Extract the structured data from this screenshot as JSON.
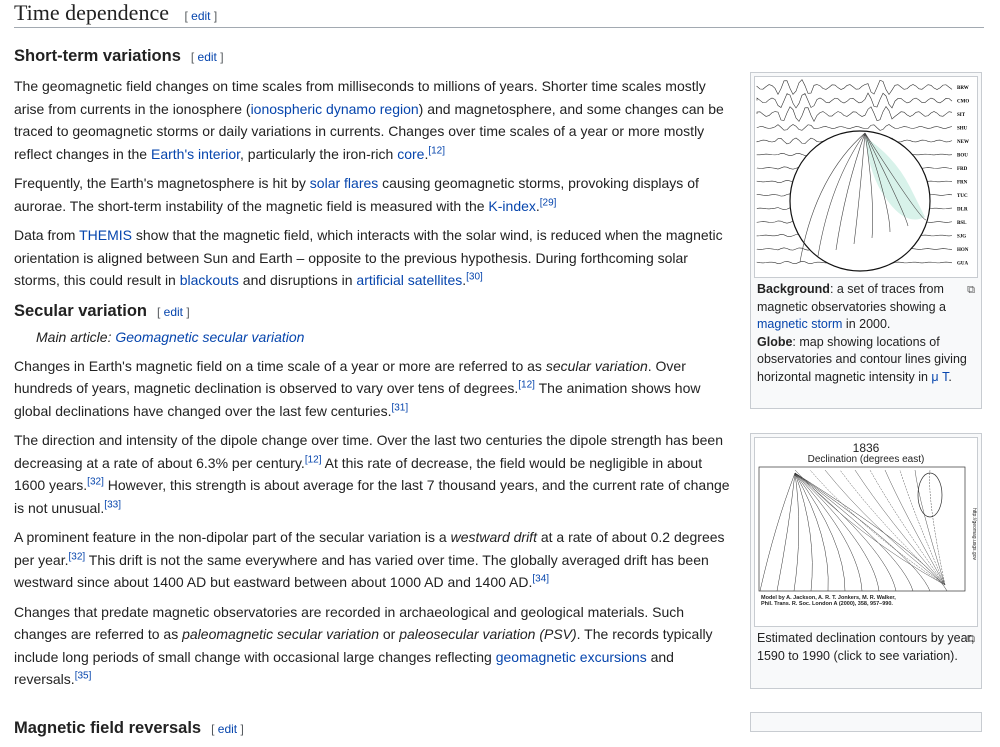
{
  "section": {
    "title": "Time dependence",
    "edit": "edit"
  },
  "edit_open": "[",
  "edit_close": "]",
  "subsections": [
    {
      "title": "Short-term variations",
      "edit": "edit",
      "hatnote": null,
      "paragraphs": [
        [
          {
            "t": "The geomagnetic field changes on time scales from milliseconds to millions of years. Shorter time scales mostly arise from currents in the ionosphere ("
          },
          {
            "t": "ionospheric dynamo region",
            "link": 1
          },
          {
            "t": ") and magnetosphere, and some changes can be traced to geomagnetic storms or daily variations in currents. Changes over time scales of a year or more mostly reflect changes in the "
          },
          {
            "t": "Earth's interior",
            "link": 1
          },
          {
            "t": ", particularly the iron-rich "
          },
          {
            "t": "core",
            "link": 1
          },
          {
            "t": ".",
            "sup": "[12]"
          }
        ],
        [
          {
            "t": "Frequently, the Earth's magnetosphere is hit by "
          },
          {
            "t": "solar flares",
            "link": 1
          },
          {
            "t": " causing geomagnetic storms, provoking displays of aurorae. The short-term instability of the magnetic field is measured with the "
          },
          {
            "t": "K-index",
            "link": 1
          },
          {
            "t": ".",
            "sup": "[29]"
          }
        ],
        [
          {
            "t": "Data from "
          },
          {
            "t": "THEMIS",
            "link": 1
          },
          {
            "t": " show that the magnetic field, which interacts with the solar wind, is reduced when the magnetic orientation is aligned between Sun and Earth – opposite to the previous hypothesis. During forthcoming solar storms, this could result in "
          },
          {
            "t": "blackouts",
            "link": 1
          },
          {
            "t": " and disruptions in "
          },
          {
            "t": "artificial satellites",
            "link": 1
          },
          {
            "t": ".",
            "sup": "[30]"
          }
        ]
      ]
    },
    {
      "title": "Secular variation",
      "edit": "edit",
      "hatnote": {
        "label": "Main article: ",
        "link": "Geomagnetic secular variation"
      },
      "paragraphs": [
        [
          {
            "t": "Changes in Earth's magnetic field on a time scale of a year or more are referred to as "
          },
          {
            "t": "secular variation",
            "i": 1
          },
          {
            "t": ". Over hundreds of years, magnetic declination is observed to vary over tens of degrees.",
            "sup": "[12]"
          },
          {
            "t": " The animation shows how global declinations have changed over the last few centuries.",
            "sup": "[31]"
          }
        ],
        [
          {
            "t": "The direction and intensity of the dipole change over time. Over the last two centuries the dipole strength has been decreasing at a rate of about 6.3% per century.",
            "sup": "[12]"
          },
          {
            "t": " At this rate of decrease, the field would be negligible in about 1600 years.",
            "sup": "[32]"
          },
          {
            "t": " However, this strength is about average for the last 7 thousand years, and the current rate of change is not unusual.",
            "sup": "[33]"
          }
        ],
        [
          {
            "t": "A prominent feature in the non-dipolar part of the secular variation is a "
          },
          {
            "t": "westward drift",
            "i": 1
          },
          {
            "t": " at a rate of about 0.2 degrees per year.",
            "sup": "[32]"
          },
          {
            "t": " This drift is not the same everywhere and has varied over time. The globally averaged drift has been westward since about 1400 AD but eastward between about 1000 AD and 1400 AD.",
            "sup": "[34]"
          }
        ],
        [
          {
            "t": "Changes that predate magnetic observatories are recorded in archaeological and geological materials. Such changes are referred to as "
          },
          {
            "t": "paleomagnetic secular variation",
            "i": 1
          },
          {
            "t": " or "
          },
          {
            "t": "paleosecular variation (PSV)",
            "i": 1
          },
          {
            "t": ". The records typically include long periods of small change with occasional large changes reflecting "
          },
          {
            "t": "geomagnetic excursions",
            "link": 1
          },
          {
            "t": " and reversals.",
            "sup": "[35]"
          }
        ]
      ]
    },
    {
      "title": "Magnetic field reversals",
      "edit": "edit",
      "hatnote": null,
      "paragraphs": []
    }
  ],
  "figures": [
    {
      "stations": [
        "BRW",
        "CMO",
        "SIT",
        "SHU",
        "NEW",
        "BOU",
        "FRD",
        "FRN",
        "TUC",
        "DLR",
        "BSL",
        "SJG",
        "HON",
        "GUA"
      ],
      "caption": [
        {
          "t": "Background",
          "b": 1
        },
        {
          "t": ": a set of traces from magnetic observatories showing a "
        },
        {
          "t": "magnetic storm",
          "link": 1
        },
        {
          "t": " in 2000."
        },
        {
          "br": 1
        },
        {
          "t": "Globe",
          "b": 1
        },
        {
          "t": ": map showing locations of observatories and contour lines giving horizontal magnetic intensity in "
        },
        {
          "t": "μ T",
          "link": 1
        },
        {
          "t": "."
        }
      ]
    },
    {
      "year": "1836",
      "subtitle": "Declination (degrees east)",
      "credit1": "Model by A. Jackson, A. R. T. Jonkers, M. R. Walker,",
      "credit2": "Phil. Trans. R. Soc. London A (2000), 358, 957–990.",
      "side": "http://geomag.usgs.gov",
      "caption": [
        {
          "t": "Estimated declination contours by year, 1590 to 1990 (click to see variation)."
        }
      ]
    }
  ],
  "enlarge_icon": "enlarge-icon"
}
